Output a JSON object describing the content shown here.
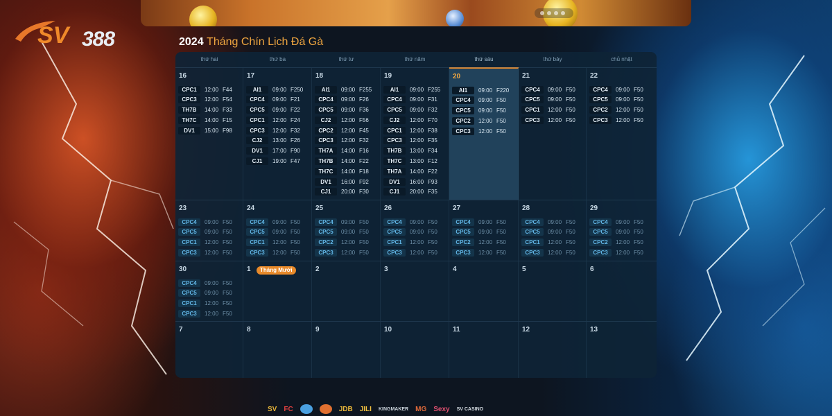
{
  "brand": {
    "logo_letters": "SV",
    "logo_number": "388"
  },
  "banner": {
    "label": "Promotional banner"
  },
  "title": {
    "year": "2024",
    "text": "Tháng Chín Lịch Đá Gà"
  },
  "weekdays": [
    "thứ hai",
    "thứ ba",
    "thứ tư",
    "thứ năm",
    "thứ sáu",
    "thứ bảy",
    "chủ nhật"
  ],
  "today_index": 4,
  "weeks": [
    {
      "days": [
        {
          "num": "16",
          "events": [
            {
              "code": "CPC1",
              "time": "12:00",
              "fee": "F44"
            },
            {
              "code": "CPC3",
              "time": "12:00",
              "fee": "F54"
            },
            {
              "code": "TH7B",
              "time": "14:00",
              "fee": "F33"
            },
            {
              "code": "TH7C",
              "time": "14:00",
              "fee": "F15"
            },
            {
              "code": "DV1",
              "time": "15:00",
              "fee": "F98"
            }
          ]
        },
        {
          "num": "17",
          "events": [
            {
              "code": "AI1",
              "time": "09:00",
              "fee": "F250"
            },
            {
              "code": "CPC4",
              "time": "09:00",
              "fee": "F21"
            },
            {
              "code": "CPC5",
              "time": "09:00",
              "fee": "F22"
            },
            {
              "code": "CPC1",
              "time": "12:00",
              "fee": "F24"
            },
            {
              "code": "CPC3",
              "time": "12:00",
              "fee": "F32"
            },
            {
              "code": "CJ2",
              "time": "13:00",
              "fee": "F26"
            },
            {
              "code": "DV1",
              "time": "17:00",
              "fee": "F90"
            },
            {
              "code": "CJ1",
              "time": "19:00",
              "fee": "F47"
            }
          ]
        },
        {
          "num": "18",
          "events": [
            {
              "code": "AI1",
              "time": "09:00",
              "fee": "F255"
            },
            {
              "code": "CPC4",
              "time": "09:00",
              "fee": "F26"
            },
            {
              "code": "CPC5",
              "time": "09:00",
              "fee": "F36"
            },
            {
              "code": "CJ2",
              "time": "12:00",
              "fee": "F56"
            },
            {
              "code": "CPC2",
              "time": "12:00",
              "fee": "F45"
            },
            {
              "code": "CPC3",
              "time": "12:00",
              "fee": "F32"
            },
            {
              "code": "TH7A",
              "time": "14:00",
              "fee": "F16"
            },
            {
              "code": "TH7B",
              "time": "14:00",
              "fee": "F22"
            },
            {
              "code": "TH7C",
              "time": "14:00",
              "fee": "F18"
            },
            {
              "code": "DV1",
              "time": "16:00",
              "fee": "F92"
            },
            {
              "code": "CJ1",
              "time": "20:00",
              "fee": "F30"
            }
          ]
        },
        {
          "num": "19",
          "events": [
            {
              "code": "AI1",
              "time": "09:00",
              "fee": "F255"
            },
            {
              "code": "CPC4",
              "time": "09:00",
              "fee": "F31"
            },
            {
              "code": "CPC5",
              "time": "09:00",
              "fee": "F32"
            },
            {
              "code": "CJ2",
              "time": "12:00",
              "fee": "F70"
            },
            {
              "code": "CPC1",
              "time": "12:00",
              "fee": "F38"
            },
            {
              "code": "CPC3",
              "time": "12:00",
              "fee": "F35"
            },
            {
              "code": "TH7B",
              "time": "13:00",
              "fee": "F34"
            },
            {
              "code": "TH7C",
              "time": "13:00",
              "fee": "F12"
            },
            {
              "code": "TH7A",
              "time": "14:00",
              "fee": "F22"
            },
            {
              "code": "DV1",
              "time": "16:00",
              "fee": "F93"
            },
            {
              "code": "CJ1",
              "time": "20:00",
              "fee": "F35"
            }
          ]
        },
        {
          "num": "20",
          "events": [
            {
              "code": "AI1",
              "time": "09:00",
              "fee": "F220"
            },
            {
              "code": "CPC4",
              "time": "09:00",
              "fee": "F50"
            },
            {
              "code": "CPC5",
              "time": "09:00",
              "fee": "F50"
            },
            {
              "code": "CPC2",
              "time": "12:00",
              "fee": "F50"
            },
            {
              "code": "CPC3",
              "time": "12:00",
              "fee": "F50"
            }
          ]
        },
        {
          "num": "21",
          "events": [
            {
              "code": "CPC4",
              "time": "09:00",
              "fee": "F50"
            },
            {
              "code": "CPC5",
              "time": "09:00",
              "fee": "F50"
            },
            {
              "code": "CPC1",
              "time": "12:00",
              "fee": "F50"
            },
            {
              "code": "CPC3",
              "time": "12:00",
              "fee": "F50"
            }
          ]
        },
        {
          "num": "22",
          "events": [
            {
              "code": "CPC4",
              "time": "09:00",
              "fee": "F50"
            },
            {
              "code": "CPC5",
              "time": "09:00",
              "fee": "F50"
            },
            {
              "code": "CPC2",
              "time": "12:00",
              "fee": "F50"
            },
            {
              "code": "CPC3",
              "time": "12:00",
              "fee": "F50"
            }
          ]
        }
      ]
    },
    {
      "days": [
        {
          "num": "23",
          "events": [
            {
              "code": "CPC4",
              "time": "09:00",
              "fee": "F50"
            },
            {
              "code": "CPC5",
              "time": "09:00",
              "fee": "F50"
            },
            {
              "code": "CPC1",
              "time": "12:00",
              "fee": "F50"
            },
            {
              "code": "CPC3",
              "time": "12:00",
              "fee": "F50"
            }
          ]
        },
        {
          "num": "24",
          "events": [
            {
              "code": "CPC4",
              "time": "09:00",
              "fee": "F50"
            },
            {
              "code": "CPC5",
              "time": "09:00",
              "fee": "F50"
            },
            {
              "code": "CPC1",
              "time": "12:00",
              "fee": "F50"
            },
            {
              "code": "CPC3",
              "time": "12:00",
              "fee": "F50"
            }
          ]
        },
        {
          "num": "25",
          "events": [
            {
              "code": "CPC4",
              "time": "09:00",
              "fee": "F50"
            },
            {
              "code": "CPC5",
              "time": "09:00",
              "fee": "F50"
            },
            {
              "code": "CPC2",
              "time": "12:00",
              "fee": "F50"
            },
            {
              "code": "CPC3",
              "time": "12:00",
              "fee": "F50"
            }
          ]
        },
        {
          "num": "26",
          "events": [
            {
              "code": "CPC4",
              "time": "09:00",
              "fee": "F50"
            },
            {
              "code": "CPC5",
              "time": "09:00",
              "fee": "F50"
            },
            {
              "code": "CPC1",
              "time": "12:00",
              "fee": "F50"
            },
            {
              "code": "CPC3",
              "time": "12:00",
              "fee": "F50"
            }
          ]
        },
        {
          "num": "27",
          "events": [
            {
              "code": "CPC4",
              "time": "09:00",
              "fee": "F50"
            },
            {
              "code": "CPC5",
              "time": "09:00",
              "fee": "F50"
            },
            {
              "code": "CPC2",
              "time": "12:00",
              "fee": "F50"
            },
            {
              "code": "CPC3",
              "time": "12:00",
              "fee": "F50"
            }
          ]
        },
        {
          "num": "28",
          "events": [
            {
              "code": "CPC4",
              "time": "09:00",
              "fee": "F50"
            },
            {
              "code": "CPC5",
              "time": "09:00",
              "fee": "F50"
            },
            {
              "code": "CPC1",
              "time": "12:00",
              "fee": "F50"
            },
            {
              "code": "CPC3",
              "time": "12:00",
              "fee": "F50"
            }
          ]
        },
        {
          "num": "29",
          "events": [
            {
              "code": "CPC4",
              "time": "09:00",
              "fee": "F50"
            },
            {
              "code": "CPC5",
              "time": "09:00",
              "fee": "F50"
            },
            {
              "code": "CPC2",
              "time": "12:00",
              "fee": "F50"
            },
            {
              "code": "CPC3",
              "time": "12:00",
              "fee": "F50"
            }
          ]
        }
      ]
    },
    {
      "days": [
        {
          "num": "30",
          "events": [
            {
              "code": "CPC4",
              "time": "09:00",
              "fee": "F50"
            },
            {
              "code": "CPC5",
              "time": "09:00",
              "fee": "F50"
            },
            {
              "code": "CPC1",
              "time": "12:00",
              "fee": "F50"
            },
            {
              "code": "CPC3",
              "time": "12:00",
              "fee": "F50"
            }
          ]
        },
        {
          "num": "1",
          "pill": "Tháng Mười",
          "events": []
        },
        {
          "num": "2",
          "events": []
        },
        {
          "num": "3",
          "events": []
        },
        {
          "num": "4",
          "events": []
        },
        {
          "num": "5",
          "events": []
        },
        {
          "num": "6",
          "events": []
        }
      ]
    },
    {
      "days": [
        {
          "num": "7",
          "events": []
        },
        {
          "num": "8",
          "events": []
        },
        {
          "num": "9",
          "events": []
        },
        {
          "num": "10",
          "events": []
        },
        {
          "num": "11",
          "events": []
        },
        {
          "num": "12",
          "events": []
        },
        {
          "num": "13",
          "events": []
        }
      ]
    }
  ],
  "partners": [
    {
      "name": "SV",
      "color": "#e8b63a"
    },
    {
      "name": "FC",
      "color": "#e04040"
    },
    {
      "name": "",
      "color": "#4aa0e0",
      "icon": "globe-logo-icon"
    },
    {
      "name": "",
      "color": "#e07030",
      "icon": "dragon-logo-icon"
    },
    {
      "name": "JDB",
      "color": "#e8b63a"
    },
    {
      "name": "JILI",
      "color": "#f0c040"
    },
    {
      "name": "KINGMAKER",
      "color": "#c9d2da"
    },
    {
      "name": "MG",
      "color": "#e06a3a"
    },
    {
      "name": "Sexy",
      "color": "#e05070"
    },
    {
      "name": "SV CASINO",
      "color": "#d6dde3"
    }
  ]
}
